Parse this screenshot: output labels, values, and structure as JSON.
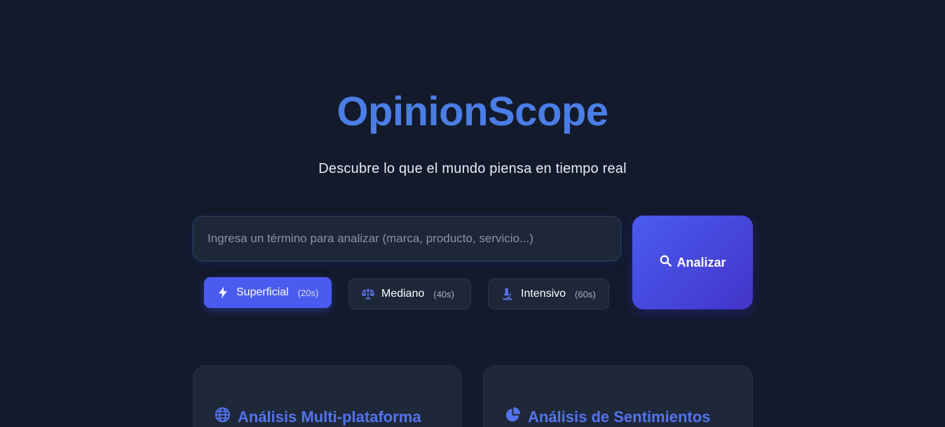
{
  "brand": {
    "name": "OpinionScope",
    "tagline": "Descubre lo que el mundo piensa en tiempo real"
  },
  "search": {
    "placeholder": "Ingresa un término para analizar (marca, producto, servicio...)",
    "value": ""
  },
  "analyze_button": {
    "label": "Analizar",
    "icon": "search-icon"
  },
  "modes": [
    {
      "label": "Superficial",
      "duration": "(20s)",
      "icon": "bolt-icon",
      "active": true
    },
    {
      "label": "Mediano",
      "duration": "(40s)",
      "icon": "balance-scale-icon",
      "active": false
    },
    {
      "label": "Intensivo",
      "duration": "(60s)",
      "icon": "microscope-icon",
      "active": false
    }
  ],
  "features": [
    {
      "title": "Análisis Multi-plataforma",
      "icon": "globe-icon"
    },
    {
      "title": "Análisis de Sentimientos",
      "icon": "pie-chart-icon"
    }
  ],
  "colors": {
    "background": "#131a2b",
    "accent": "#4a5cf0",
    "brand": "#4a7ee6",
    "card": "#1f2839"
  }
}
